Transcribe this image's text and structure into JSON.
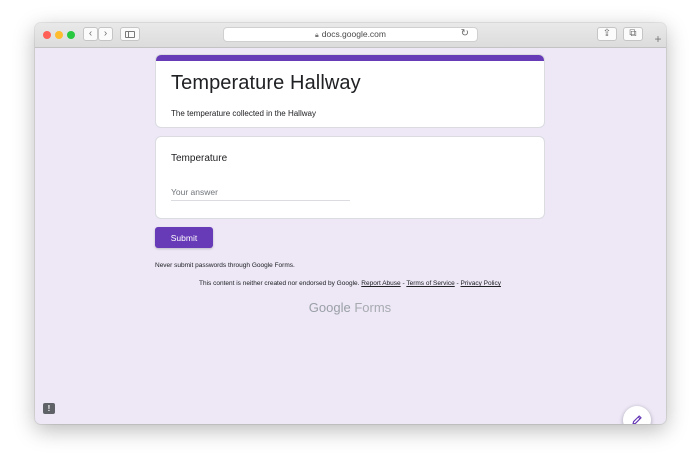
{
  "browser": {
    "url": "docs.google.com",
    "back_glyph": "‹",
    "forward_glyph": "›",
    "share_glyph": "⇪",
    "tabs_glyph": "⧉",
    "reload_glyph": "↻",
    "new_tab_glyph": "+"
  },
  "form": {
    "title": "Temperature Hallway",
    "description": "The temperature collected in the Hallway",
    "accent_color": "#673ab7",
    "background_color": "#ede7f6",
    "question": {
      "label": "Temperature",
      "placeholder": "Your answer",
      "value": ""
    },
    "submit_label": "Submit"
  },
  "footer": {
    "password_note": "Never submit passwords through Google Forms.",
    "disclaimer_prefix": "This content is neither created nor endorsed by Google.",
    "report_abuse": "Report Abuse",
    "separator": " - ",
    "terms": "Terms of Service",
    "privacy": "Privacy Policy",
    "brand_google": "Google",
    "brand_forms": "Forms"
  },
  "widgets": {
    "report_glyph": "!",
    "edit_icon": "pencil-icon"
  }
}
